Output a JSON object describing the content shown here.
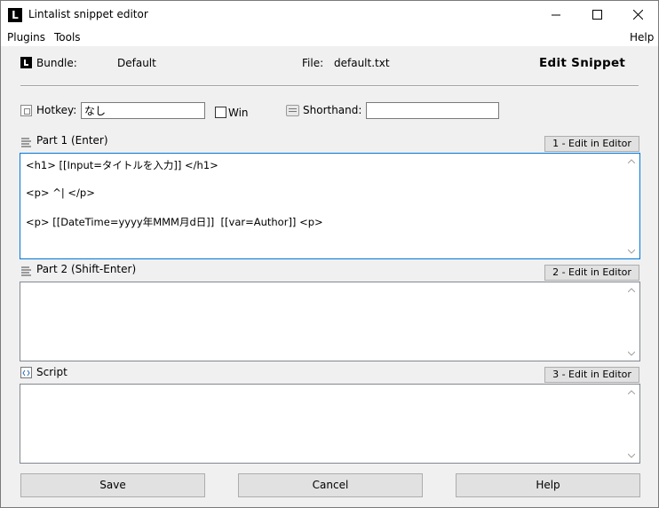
{
  "window": {
    "title": "Lintalist snippet editor",
    "app_icon_letter": "L"
  },
  "menu": {
    "plugins": "Plugins",
    "tools": "Tools",
    "help": "Help"
  },
  "header": {
    "bundle_label": "Bundle:",
    "bundle_value": "Default",
    "file_label": "File:",
    "file_value": "default.txt",
    "mode_title": "Edit Snippet"
  },
  "hotkey": {
    "label": "Hotkey:",
    "value": "なし",
    "win_label": "Win",
    "win_checked": false
  },
  "shorthand": {
    "label": "Shorthand:",
    "value": ""
  },
  "part1": {
    "label": "Part 1 (Enter)",
    "edit_button": "1 - Edit in Editor",
    "lines": [
      "<h1> [[Input=タイトルを入力]] </h1>",
      "<p> ^| </p>",
      "<p> [[DateTime=yyyy年MMM月d日]]  [[var=Author]] <p>"
    ]
  },
  "part2": {
    "label": "Part 2 (Shift-Enter)",
    "edit_button": "2 - Edit in Editor",
    "lines": []
  },
  "script": {
    "label": "Script",
    "edit_button": "3 - Edit in Editor",
    "lines": []
  },
  "buttons": {
    "save": "Save",
    "cancel": "Cancel",
    "help": "Help"
  }
}
